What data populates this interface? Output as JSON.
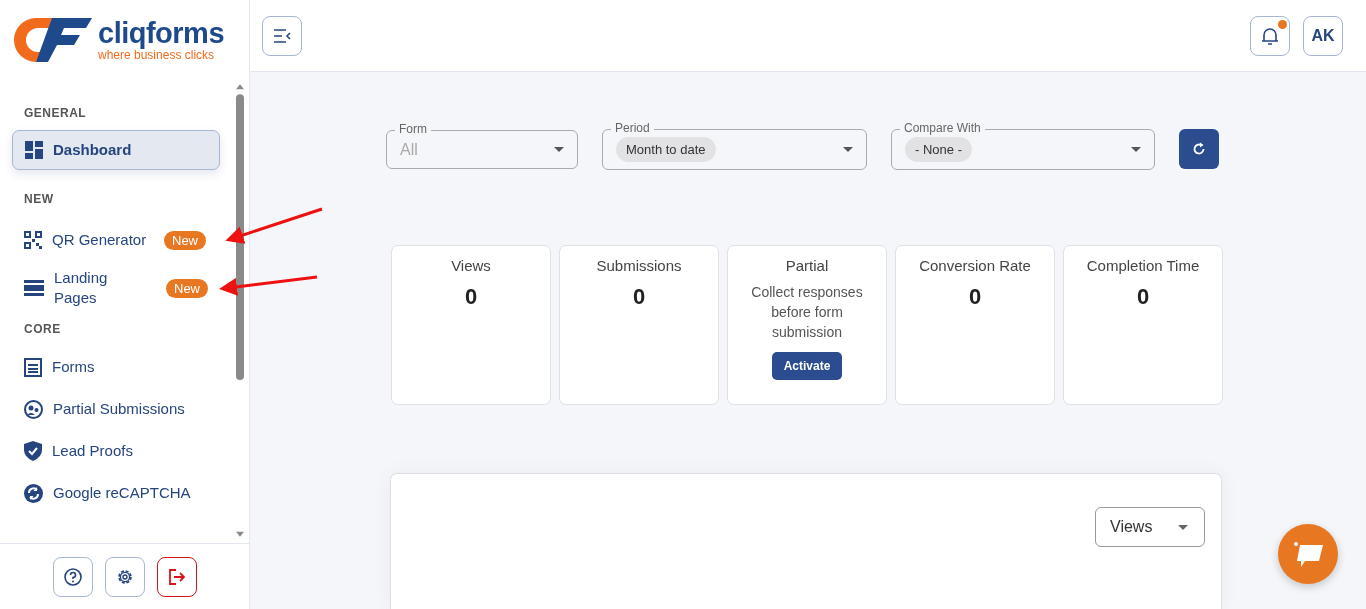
{
  "logo": {
    "name": "cliqforms",
    "tagline": "where business clicks"
  },
  "sidebar": {
    "sections": [
      {
        "heading": "GENERAL",
        "items": [
          {
            "label": "Dashboard",
            "kind": "dashboard",
            "selected": true
          }
        ]
      },
      {
        "heading": "NEW",
        "items": [
          {
            "label": "QR Generator",
            "kind": "qr",
            "badge": "New",
            "selected": false
          },
          {
            "label": "Landing Pages",
            "kind": "landing",
            "badge": "New",
            "selected": false
          }
        ]
      },
      {
        "heading": "CORE",
        "items": [
          {
            "label": "Forms",
            "kind": "forms",
            "selected": false
          },
          {
            "label": "Partial Submissions",
            "kind": "partial",
            "selected": false
          },
          {
            "label": "Lead Proofs",
            "kind": "shield",
            "selected": false
          },
          {
            "label": "Google reCAPTCHA",
            "kind": "recaptcha",
            "selected": false
          }
        ]
      }
    ],
    "footer_buttons": [
      {
        "kind": "help"
      },
      {
        "kind": "settings"
      },
      {
        "kind": "logout"
      }
    ]
  },
  "header": {
    "notifications": {
      "unread": true
    },
    "avatar": "AK"
  },
  "filters": [
    {
      "label": "Form",
      "placeholder": "All"
    },
    {
      "label": "Period",
      "value": "Month to date"
    },
    {
      "label": "Compare With",
      "value": "- None -"
    }
  ],
  "stats": [
    {
      "label": "Views",
      "value": "0"
    },
    {
      "label": "Submissions",
      "value": "0"
    },
    {
      "label": "Partial",
      "description": "Collect responses before form submission",
      "action": "Activate"
    },
    {
      "label": "Conversion Rate",
      "value": "0"
    },
    {
      "label": "Completion Time",
      "value": "0"
    }
  ],
  "chart_panel": {
    "metric": "Views"
  }
}
